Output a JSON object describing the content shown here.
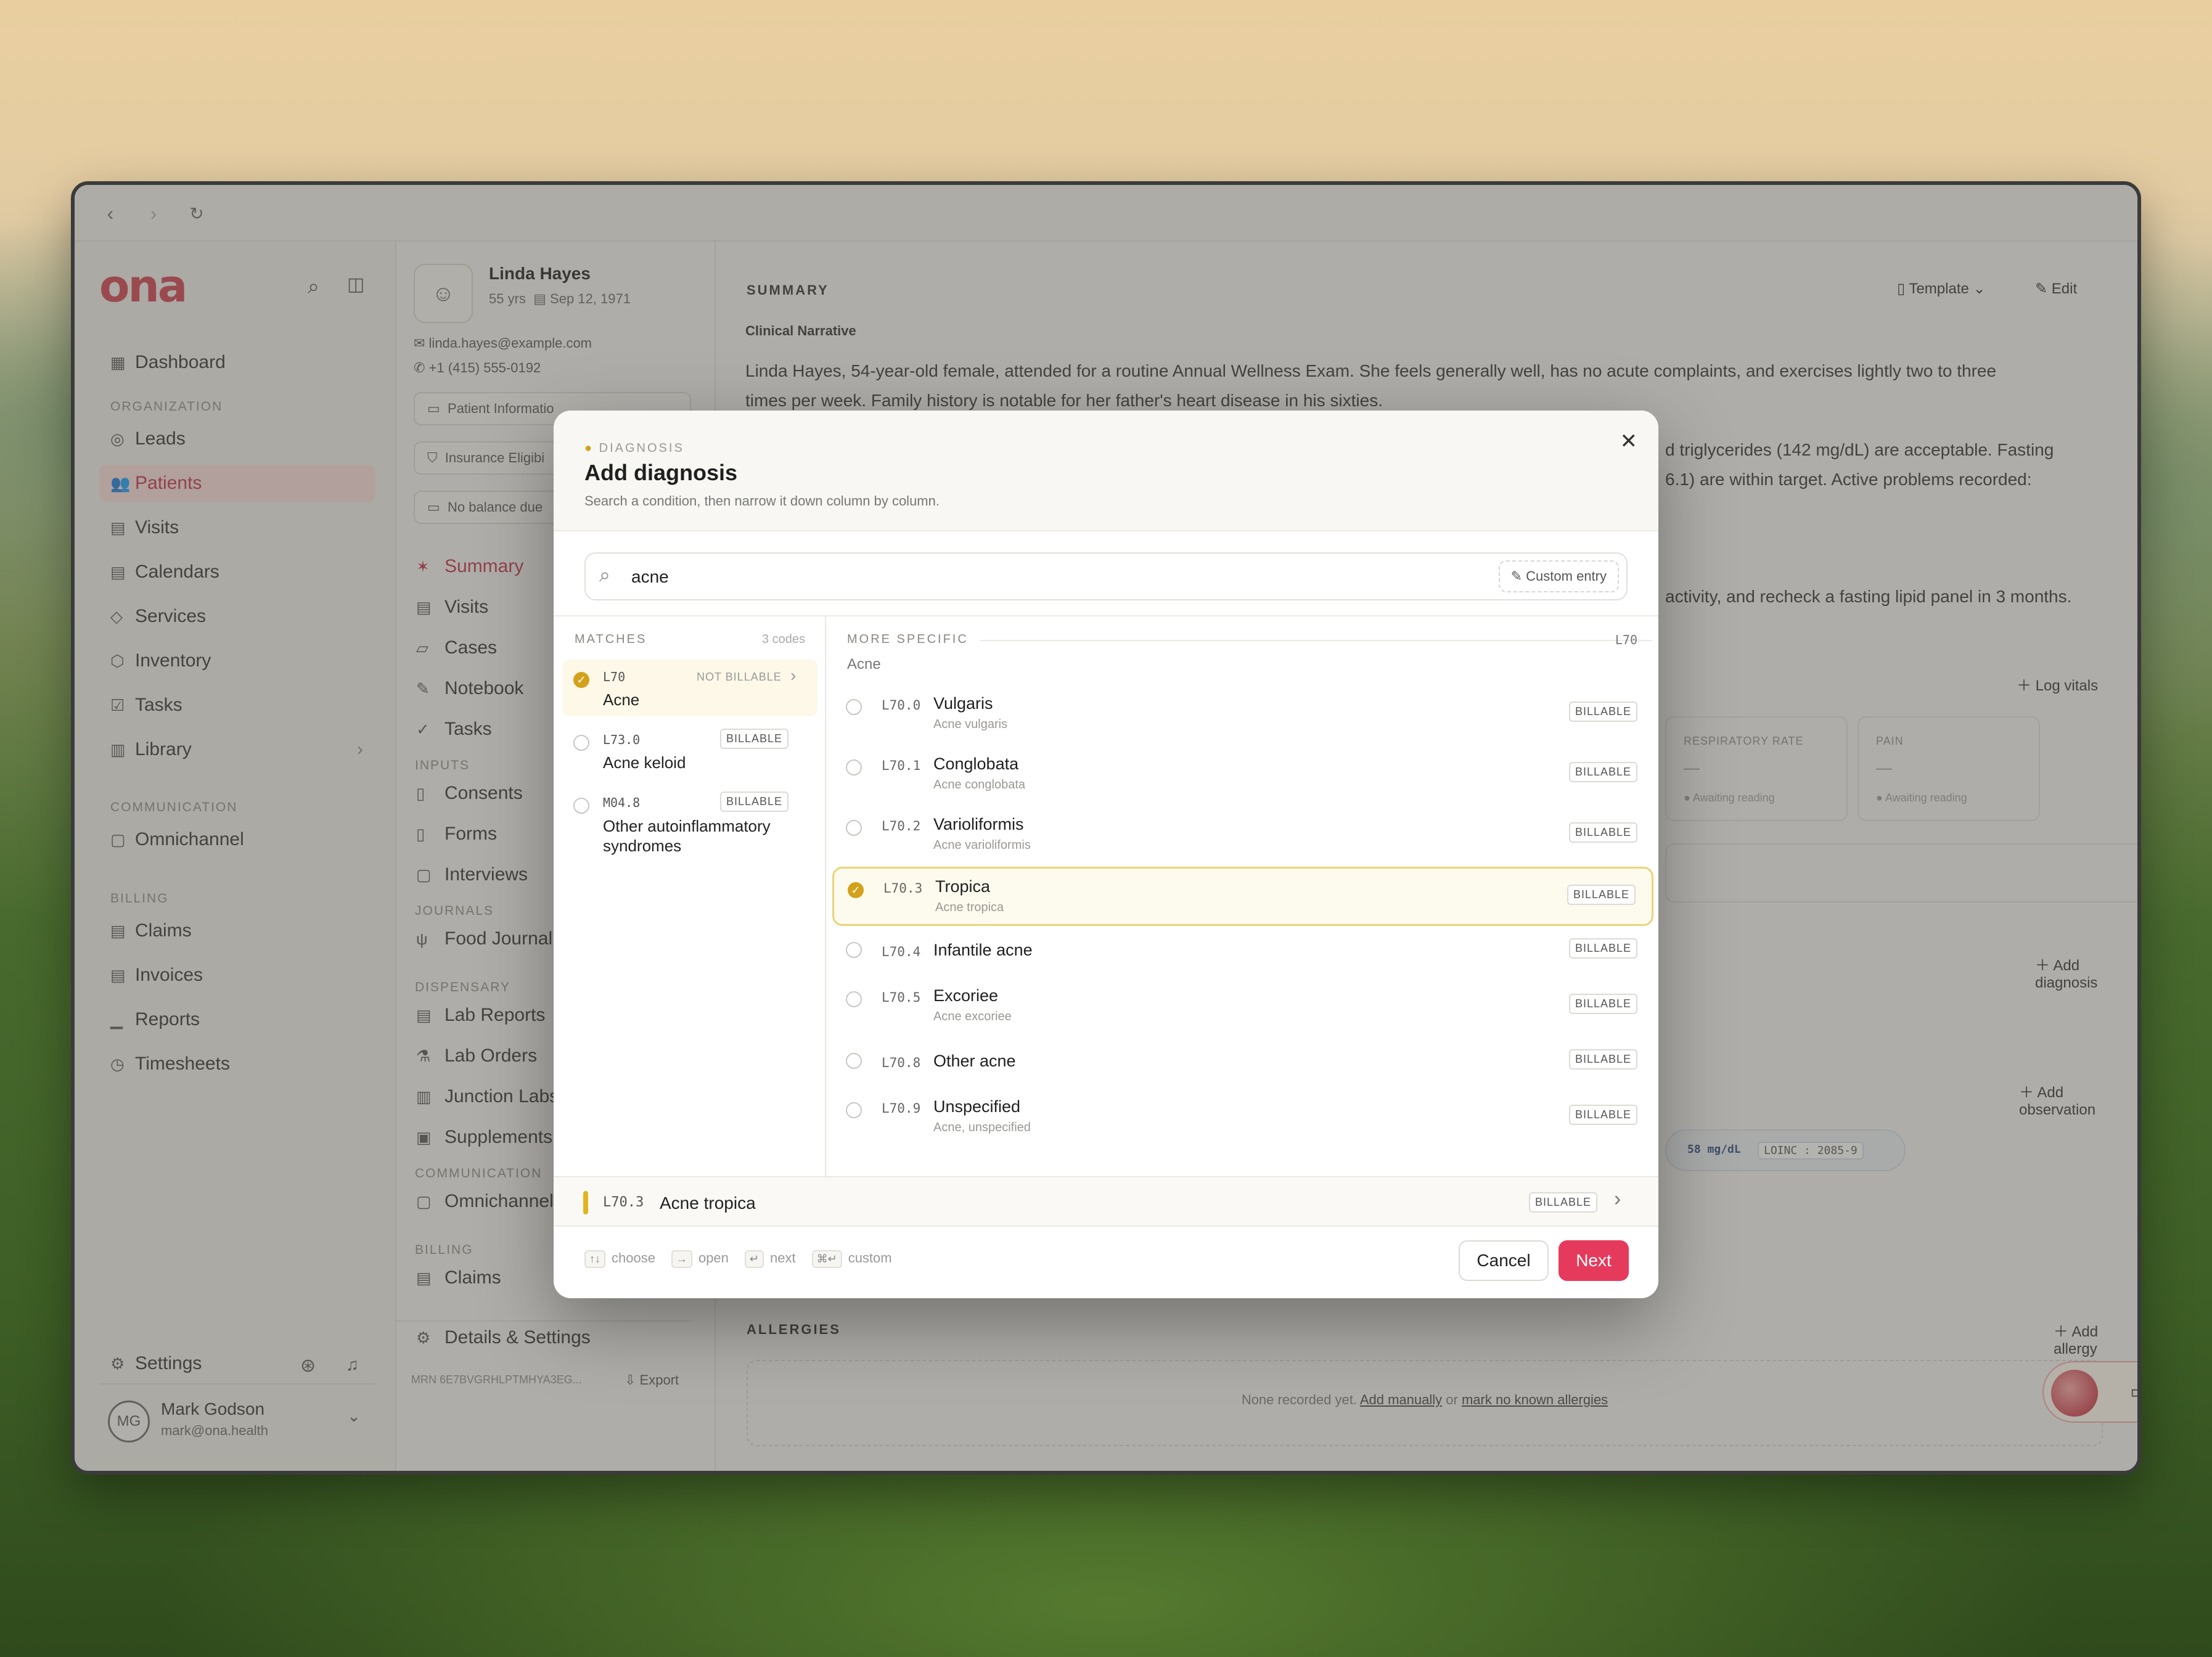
{
  "browser": {
    "back_icon": "back-arrow-icon",
    "forward_icon": "forward-arrow-icon",
    "reload_icon": "reload-icon"
  },
  "brand": {
    "logo": "ona",
    "accent": "#c8414f",
    "primary": "#e63a5c",
    "highlight": "#d3a21a"
  },
  "sidebar": {
    "dashboard": "Dashboard",
    "section_org": "ORGANIZATION",
    "org_items": [
      "Leads",
      "Patients",
      "Visits",
      "Calendars",
      "Services",
      "Inventory",
      "Tasks",
      "Library"
    ],
    "section_comm": "COMMUNICATION",
    "comm_items": [
      "Omnichannel"
    ],
    "section_billing": "BILLING",
    "billing_items": [
      "Claims",
      "Invoices",
      "Reports",
      "Timesheets"
    ],
    "settings": "Settings",
    "user_initials": "MG",
    "user_name": "Mark Godson",
    "user_email": "mark@ona.health"
  },
  "patient": {
    "name": "Linda Hayes",
    "age": "55 yrs",
    "dob": "Sep 12, 1971",
    "email": "linda.hayes@example.com",
    "phone": "+1 (415) 555-0192",
    "pills": [
      "Patient Informatio",
      "Insurance Eligibi",
      "No balance due"
    ],
    "nav_main": [
      "Summary",
      "Visits",
      "Cases",
      "Notebook",
      "Tasks"
    ],
    "section_inputs": "INPUTS",
    "nav_inputs": [
      "Consents",
      "Forms",
      "Interviews"
    ],
    "section_journals": "JOURNALS",
    "nav_journals": [
      "Food Journal"
    ],
    "section_dispensary": "DISPENSARY",
    "nav_dispensary": [
      "Lab Reports",
      "Lab Orders",
      "Junction Labs",
      "Supplements"
    ],
    "section_comm": "COMMUNICATION",
    "nav_comm": [
      "Omnichannel"
    ],
    "section_billing": "BILLING",
    "nav_billing": [
      "Claims"
    ],
    "details": "Details & Settings",
    "mrn": "MRN 6E7BVGRHLPTMHYA3EG...",
    "export": "Export"
  },
  "summary": {
    "heading": "SUMMARY",
    "template": "Template",
    "edit": "Edit",
    "narrative_label": "Clinical Narrative",
    "line1": "Linda Hayes, 54-year-old female, attended for a routine Annual Wellness Exam. She feels generally well, has no acute complaints, and exercises lightly two to three",
    "line2": "times per week. Family history is notable for her father's heart disease in his sixties.",
    "line3": "d triglycerides (142 mg/dL) are acceptable. Fasting",
    "line4": "6.1) are within target. Active problems recorded:",
    "line5": "activity, and recheck a fasting lipid panel in 3 months.",
    "log_vitals": "Log vitals",
    "vital1": "RESPIRATORY RATE",
    "vital2": "PAIN",
    "vital_dash": "—",
    "awaiting": "Awaiting reading",
    "add_diagnosis": "Add diagnosis",
    "add_observation": "Add observation",
    "obs_value": "58 mg/dL",
    "loinc_label": "LOINC",
    "loinc_code": "2085-9",
    "allergies": "ALLERGIES",
    "add_allergy": "Add allergy",
    "none_recorded": "None recorded yet.",
    "add_manually": "Add manually",
    "or": "or",
    "mark_nka": "mark no known allergies"
  },
  "modal": {
    "eyebrow": "DIAGNOSIS",
    "title": "Add diagnosis",
    "subtitle": "Search a condition, then narrow it down column by column.",
    "search_value": "acne",
    "custom_entry": "Custom entry",
    "matches_label": "MATCHES",
    "matches_count": "3 codes",
    "matches": [
      {
        "code": "L70",
        "name": "Acne",
        "tag": "NOT BILLABLE",
        "selected": true
      },
      {
        "code": "L73.0",
        "name": "Acne keloid",
        "tag": "BILLABLE",
        "selected": false
      },
      {
        "code": "M04.8",
        "name": "Other autoinflammatory syndromes",
        "tag": "BILLABLE",
        "selected": false
      }
    ],
    "specific_label": "MORE SPECIFIC",
    "specific_code": "L70",
    "specific_parent": "Acne",
    "specific": [
      {
        "code": "L70.0",
        "name": "Vulgaris",
        "sub": "Acne vulgaris",
        "tag": "BILLABLE",
        "selected": false
      },
      {
        "code": "L70.1",
        "name": "Conglobata",
        "sub": "Acne conglobata",
        "tag": "BILLABLE",
        "selected": false
      },
      {
        "code": "L70.2",
        "name": "Varioliformis",
        "sub": "Acne varioliformis",
        "tag": "BILLABLE",
        "selected": false
      },
      {
        "code": "L70.3",
        "name": "Tropica",
        "sub": "Acne tropica",
        "tag": "BILLABLE",
        "selected": true
      },
      {
        "code": "L70.4",
        "name": "Infantile acne",
        "sub": "",
        "tag": "BILLABLE",
        "selected": false
      },
      {
        "code": "L70.5",
        "name": "Excoriee",
        "sub": "Acne excoriee",
        "tag": "BILLABLE",
        "selected": false
      },
      {
        "code": "L70.8",
        "name": "Other acne",
        "sub": "",
        "tag": "BILLABLE",
        "selected": false
      },
      {
        "code": "L70.9",
        "name": "Unspecified",
        "sub": "Acne, unspecified",
        "tag": "BILLABLE",
        "selected": false
      }
    ],
    "selection_code": "L70.3",
    "selection_name": "Acne tropica",
    "selection_tag": "BILLABLE",
    "hints": [
      {
        "key": "↑↓",
        "label": "choose"
      },
      {
        "key": "→",
        "label": "open"
      },
      {
        "key": "↵",
        "label": "next"
      },
      {
        "key": "⌘↵",
        "label": "custom"
      }
    ],
    "cancel": "Cancel",
    "next": "Next"
  }
}
